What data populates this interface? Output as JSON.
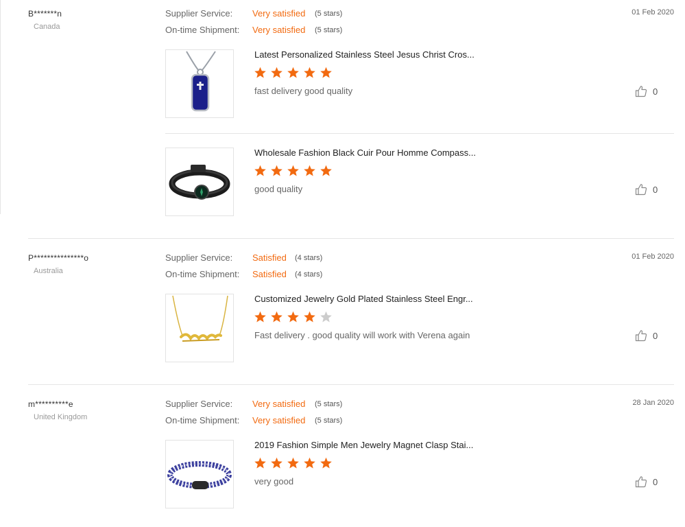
{
  "colors": {
    "accent": "#f26a10",
    "star_empty": "#cccccc",
    "divider": "#e5e5e5"
  },
  "reviews": [
    {
      "user": "B*******n",
      "country": "Canada",
      "date": "01 Feb 2020",
      "supplier_service": {
        "label": "Supplier Service:",
        "value": "Very satisfied",
        "stars_text": "(5 stars)"
      },
      "shipment": {
        "label": "On-time Shipment:",
        "value": "Very satisfied",
        "stars_text": "(5 stars)"
      },
      "items": [
        {
          "title": "Latest Personalized Stainless Steel Jesus Christ Cros...",
          "rating": 5,
          "comment": "fast delivery good quality",
          "likes": "0",
          "image_icon": "pendant-necklace-icon"
        },
        {
          "title": "Wholesale Fashion Black Cuir Pour Homme Compass...",
          "rating": 5,
          "comment": "good quality",
          "likes": "0",
          "image_icon": "leather-bracelet-icon"
        }
      ]
    },
    {
      "user": "P***************o",
      "country": "Australia",
      "date": "01 Feb 2020",
      "supplier_service": {
        "label": "Supplier Service:",
        "value": "Satisfied",
        "stars_text": "(4 stars)"
      },
      "shipment": {
        "label": "On-time Shipment:",
        "value": "Satisfied",
        "stars_text": "(4 stars)"
      },
      "items": [
        {
          "title": "Customized Jewelry Gold Plated Stainless Steel Engr...",
          "rating": 4,
          "comment": "Fast delivery . good quality will work with Verena again",
          "likes": "0",
          "image_icon": "gold-name-necklace-icon"
        }
      ]
    },
    {
      "user": "m**********e",
      "country": "United Kingdom",
      "date": "28 Jan 2020",
      "supplier_service": {
        "label": "Supplier Service:",
        "value": "Very satisfied",
        "stars_text": "(5 stars)"
      },
      "shipment": {
        "label": "On-time Shipment:",
        "value": "Very satisfied",
        "stars_text": "(5 stars)"
      },
      "items": [
        {
          "title": "2019 Fashion Simple Men Jewelry Magnet Clasp Stai...",
          "rating": 5,
          "comment": "very good",
          "likes": "0",
          "image_icon": "rope-bracelet-icon"
        }
      ]
    }
  ]
}
